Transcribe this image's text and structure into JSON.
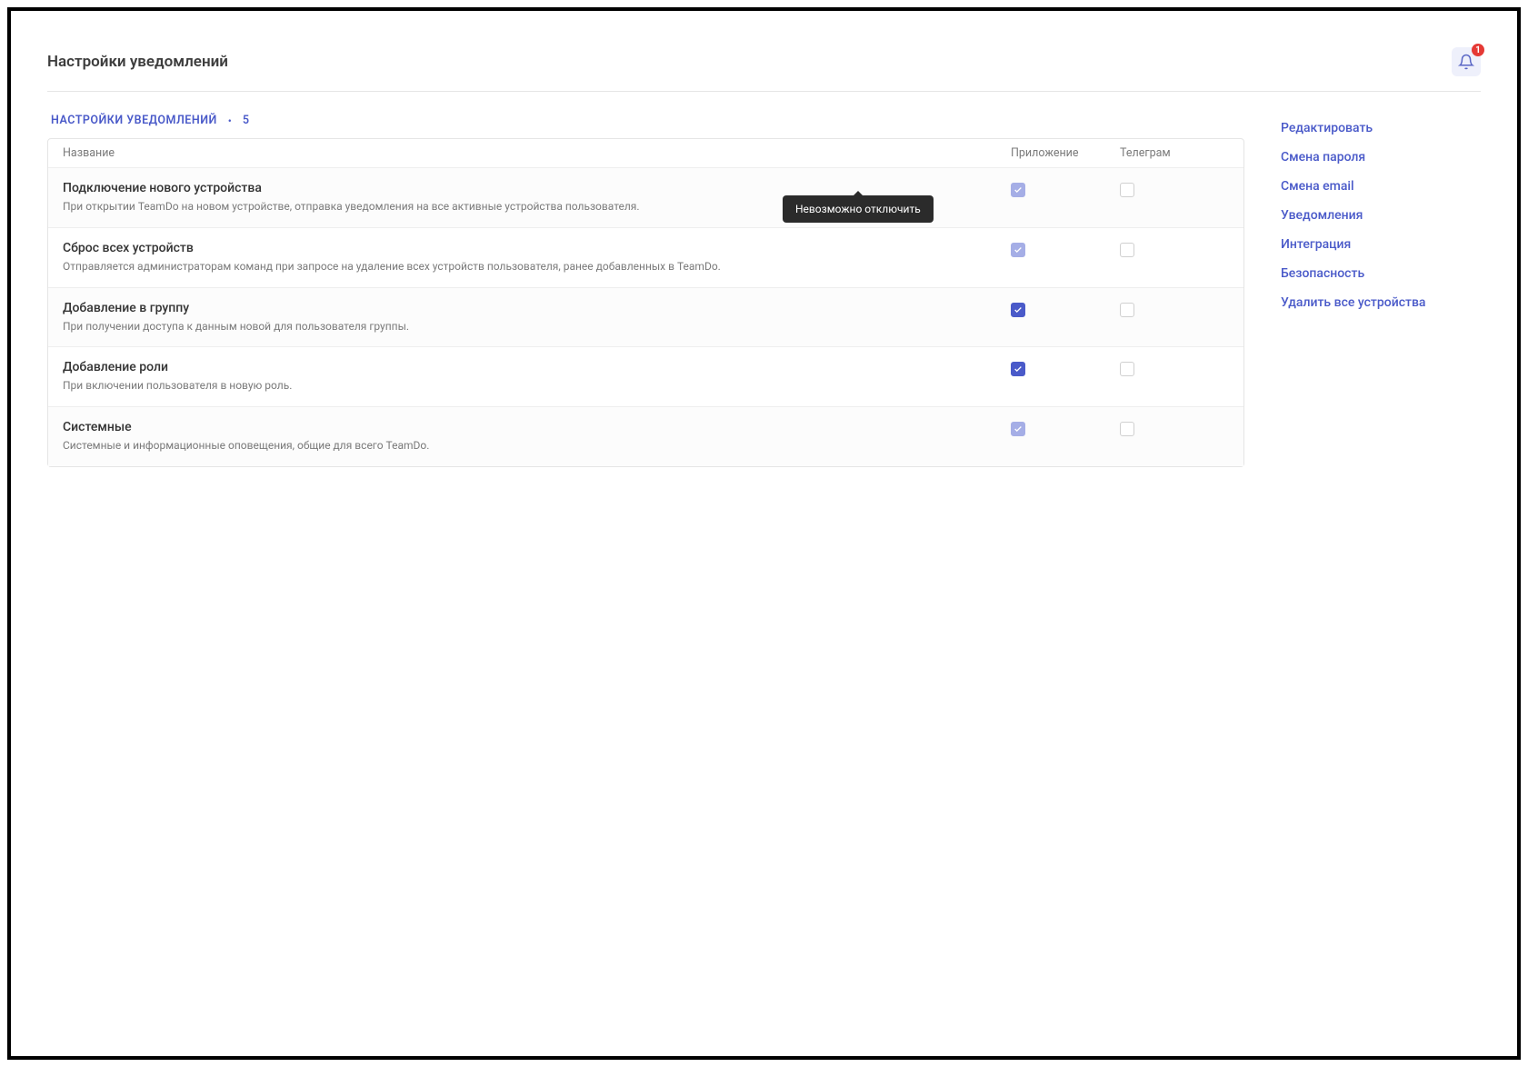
{
  "header": {
    "title": "Настройки уведомлений",
    "notification_count": "1"
  },
  "section": {
    "title": "НАСТРОЙКИ УВЕДОМЛЕНИЙ",
    "count": "5"
  },
  "columns": {
    "name": "Название",
    "app": "Приложение",
    "tg": "Телеграм"
  },
  "tooltip": "Невозможно отключить",
  "rows": [
    {
      "title": "Подключение нового устройства",
      "desc": "При открытии TeamDo на новом устройстве, отправка уведомления на все активные устройства пользователя.",
      "app_checked": true,
      "app_disabled": true,
      "tg_checked": false
    },
    {
      "title": "Сброс всех устройств",
      "desc": "Отправляется администраторам команд при запросе на удаление всех устройств пользователя, ранее добавленных в TeamDo.",
      "app_checked": true,
      "app_disabled": true,
      "tg_checked": false
    },
    {
      "title": "Добавление в группу",
      "desc": "При получении доступа к данным новой для пользователя группы.",
      "app_checked": true,
      "app_disabled": false,
      "tg_checked": false
    },
    {
      "title": "Добавление роли",
      "desc": "При включении пользователя в новую роль.",
      "app_checked": true,
      "app_disabled": false,
      "tg_checked": false
    },
    {
      "title": "Системные",
      "desc": "Системные и информационные оповещения, общие для всего TeamDo.",
      "app_checked": true,
      "app_disabled": true,
      "tg_checked": false
    }
  ],
  "sidebar": [
    "Редактировать",
    "Смена пароля",
    "Смена email",
    "Уведомления",
    "Интеграция",
    "Безопасность",
    "Удалить все устройства"
  ]
}
